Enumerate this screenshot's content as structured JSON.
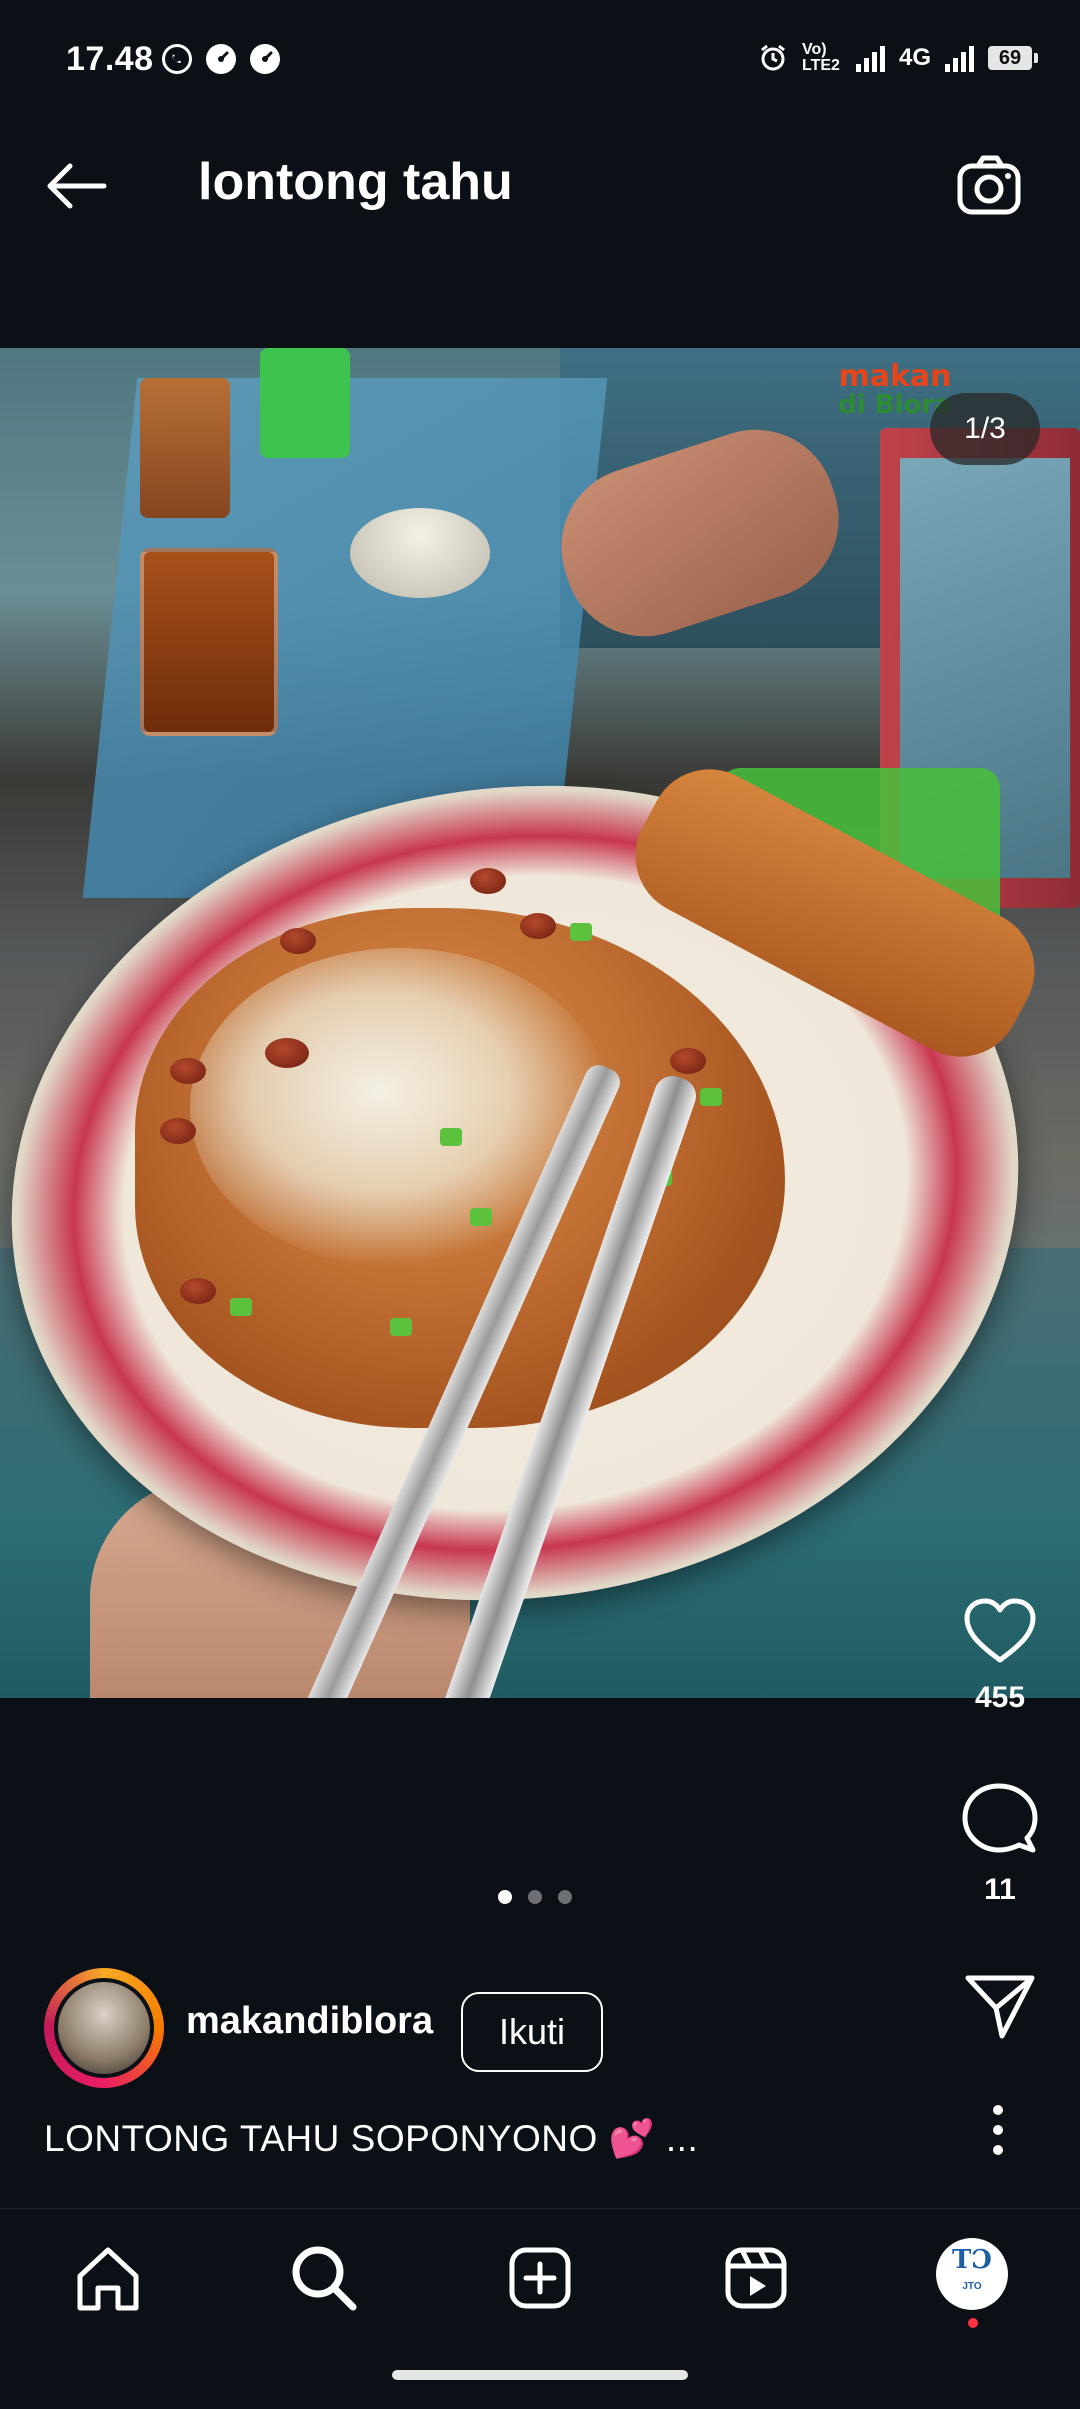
{
  "status_bar": {
    "time": "17.48",
    "network": "4G",
    "volte": "Vo) LTE2",
    "battery": "69"
  },
  "header": {
    "title": "lontong tahu"
  },
  "post": {
    "image_counter": "1/3",
    "watermark_line1": "makan",
    "watermark_line2": "di Blora",
    "carousel": {
      "total": 3,
      "active_index": 0
    }
  },
  "actions": {
    "likes": "455",
    "comments": "11"
  },
  "author": {
    "username": "makandiblora",
    "follow_label": "Ikuti"
  },
  "caption": {
    "text": "LONTONG TAHU SOPONYONO",
    "emoji": "💕",
    "more": "..."
  },
  "nav": {
    "profile_initials": "TƆ",
    "profile_sub": "JTO"
  },
  "colors": {
    "background": "#0b0f16",
    "text": "#ffffff",
    "notification_dot": "#ff3040"
  }
}
